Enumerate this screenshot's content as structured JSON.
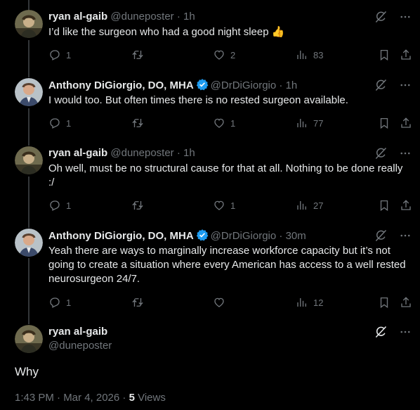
{
  "posts": [
    {
      "name": "ryan al-gaib",
      "handle": "@duneposter",
      "time": "1h",
      "text": "I’d like the surgeon who had a good night sleep 👍",
      "replies": "1",
      "reposts": "",
      "likes": "2",
      "views": "83"
    },
    {
      "name": "Anthony DiGiorgio, DO, MHA",
      "handle": "@DrDiGiorgio",
      "time": "1h",
      "text": "I would too. But often times there is no rested surgeon available.",
      "replies": "1",
      "reposts": "",
      "likes": "1",
      "views": "77"
    },
    {
      "name": "ryan al-gaib",
      "handle": "@duneposter",
      "time": "1h",
      "text": "Oh well, must be no structural cause for that at all. Nothing to be done really :/",
      "replies": "1",
      "reposts": "",
      "likes": "1",
      "views": "27"
    },
    {
      "name": "Anthony DiGiorgio, DO, MHA",
      "handle": "@DrDiGiorgio",
      "time": "30m",
      "text": "Yeah there are ways to marginally increase workforce capacity but it’s not going to create a situation where every American has access to a well rested neurosurgeon 24/7.",
      "replies": "1",
      "reposts": "",
      "likes": "",
      "views": "12"
    }
  ],
  "main_post": {
    "name": "ryan al-gaib",
    "handle": "@duneposter",
    "text": "Why",
    "timestamp": "1:43 PM · Mar 4, 2026 · ",
    "views_count": "5",
    "views_label": " Views"
  },
  "sep": " · ",
  "colors": {
    "bg": "#000000",
    "text": "#e7e9ea",
    "muted": "#71767b",
    "verified": "#1d9bf0",
    "line": "#333639"
  }
}
